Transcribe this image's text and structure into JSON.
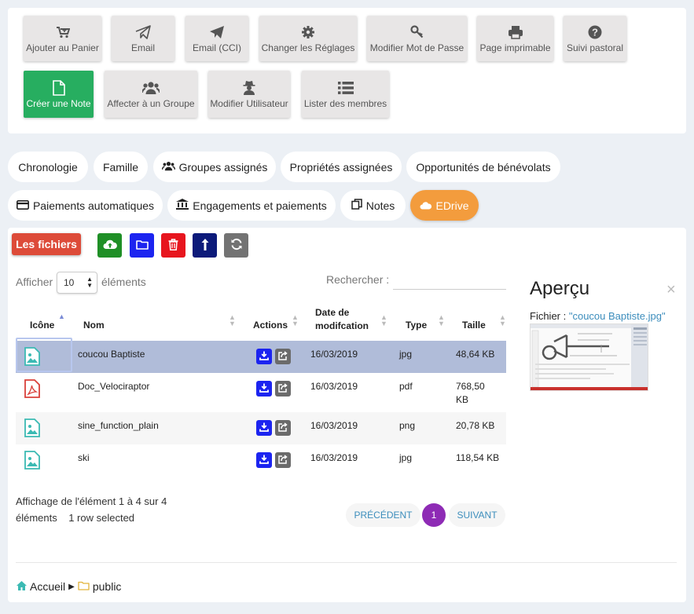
{
  "actions": {
    "add_cart": "Ajouter au Panier",
    "email": "Email",
    "email_cci": "Email (CCI)",
    "settings": "Changer les Réglages",
    "password": "Modifier Mot de Passe",
    "print": "Page imprimable",
    "pastoral": "Suivi pastoral",
    "create_note": "Créer une Note",
    "assign_group": "Affecter à un Groupe",
    "edit_user": "Modifier Utilisateur",
    "list_members": "Lister des membres"
  },
  "tabs": {
    "chrono": "Chronologie",
    "family": "Famille",
    "groups": "Groupes assignés",
    "props": "Propriétés assignées",
    "volunteer": "Opportunités de bénévolats",
    "autopay": "Paiements automatiques",
    "pledges": "Engagements et paiements",
    "notes": "Notes",
    "edrive": "EDrive"
  },
  "toolbar": {
    "files_label": "Les fichiers"
  },
  "table_controls": {
    "show": "Afficher",
    "page_size": "10",
    "entries": "éléments",
    "search_label": "Rechercher :",
    "search_value": ""
  },
  "columns": {
    "icon": "Icône",
    "name": "Nom",
    "actions": "Actions",
    "date_1": "Date de",
    "date_2": "modifcation",
    "type": "Type",
    "size": "Taille"
  },
  "rows": [
    {
      "name": "coucou Baptiste",
      "date": "16/03/2019",
      "type": "jpg",
      "size": "48,64 KB",
      "icon": "image-icon",
      "selected": true
    },
    {
      "name": "Doc_Velociraptor",
      "date": "16/03/2019",
      "type": "pdf",
      "size": "768,50 KB",
      "icon": "pdf-icon",
      "selected": false
    },
    {
      "name": "sine_function_plain",
      "date": "16/03/2019",
      "type": "png",
      "size": "20,78 KB",
      "icon": "image-icon",
      "selected": false
    },
    {
      "name": "ski",
      "date": "16/03/2019",
      "type": "jpg",
      "size": "118,54 KB",
      "icon": "image-icon",
      "selected": false
    }
  ],
  "info": {
    "line1": "Affichage de l'élément 1 à 4 sur 4",
    "line2": "éléments",
    "selected": "1 row selected"
  },
  "pagination": {
    "prev": "PRÉCÉDENT",
    "page": "1",
    "next": "SUIVANT"
  },
  "preview": {
    "title": "Aperçu",
    "file_label": "Fichier :",
    "file_name": "\"coucou Baptiste.jpg\"",
    "close": "×"
  },
  "breadcrumb": {
    "home": "Accueil",
    "folder": "public"
  },
  "colors": {
    "green": "#27ae60",
    "orange": "#f39c3d",
    "red": "#dd4b39",
    "blue": "#1c24f0",
    "navy": "#0c1a7a",
    "selected_row": "#b0bcd9",
    "purple": "#8e2bb5"
  }
}
